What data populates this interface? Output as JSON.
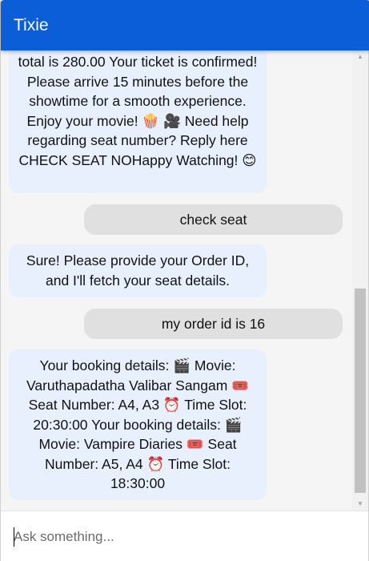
{
  "app": {
    "title": "Tixie"
  },
  "messages": [
    {
      "role": "bot",
      "text": "total is 280.00 Your ticket is confirmed! Please arrive 15 minutes before the showtime for a smooth experience. Enjoy your movie! 🍿 🎥 Need help regarding seat number? Reply here CHECK SEAT NOHappy Watching! 😊"
    },
    {
      "role": "user",
      "text": "check seat"
    },
    {
      "role": "bot",
      "text": "Sure! Please provide your Order ID, and I'll fetch your seat details."
    },
    {
      "role": "user",
      "text": "my order id is 16"
    },
    {
      "role": "bot",
      "text": "Your booking details: 🎬 Movie: Varuthapadatha Valibar Sangam 🎟️ Seat Number: A4, A3 ⏰ Time Slot: 20:30:00 Your booking details: 🎬 Movie: Vampire Diaries 🎟️ Seat Number: A5, A4 ⏰ Time Slot: 18:30:00"
    }
  ],
  "input": {
    "placeholder": "Ask something...",
    "value": ""
  },
  "colors": {
    "header": "#0b5ed7",
    "bot_bubble": "#e8f0fe",
    "user_bubble": "#e0e0e0",
    "chat_background": "#f5f5f5"
  }
}
